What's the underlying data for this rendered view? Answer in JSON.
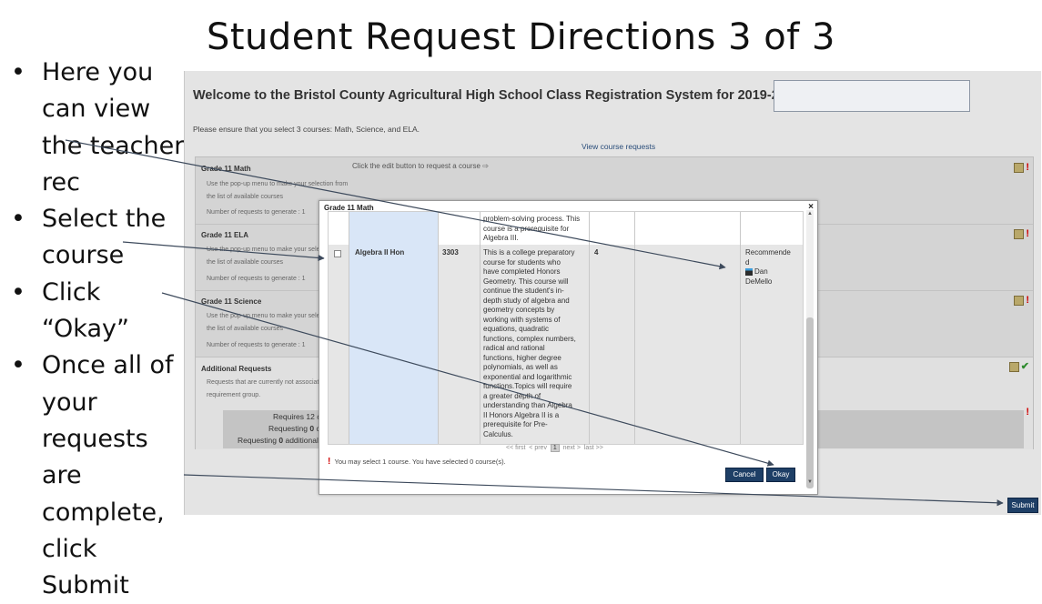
{
  "slide": {
    "title": "Student Request Directions 3 of 3",
    "bullets": [
      [
        "Here you",
        "can view",
        "the teacher",
        "rec"
      ],
      [
        "Select the",
        "course"
      ],
      [
        "Click “Okay”"
      ],
      [
        "Once all of",
        "your",
        "requests are",
        "complete,",
        "click Submit"
      ]
    ]
  },
  "app": {
    "welcome": "Welcome to the Bristol County Agricultural High School Class Registration System for 2019-2020",
    "ensure_text": "Please ensure that you select 3 courses: Math, Science, and ELA.",
    "view_requests_link": "View course requests",
    "edit_hint": "Click the edit button to request a course ⇨",
    "groups": [
      {
        "title": "Grade 11 Math",
        "line1": "Use the pop-up menu to make your selection from",
        "line2": "the list of available courses",
        "line3": "Number of requests to generate : 1"
      },
      {
        "title": "Grade 11 ELA",
        "line1": "Use the pop-up menu to make your selection from",
        "line2": "the list of available courses",
        "line3": "Number of requests to generate : 1"
      },
      {
        "title": "Grade 11 Science",
        "line1": "Use the pop-up menu to make your selection from",
        "line2": "the list of available courses",
        "line3": "Number of requests to generate : 1"
      },
      {
        "title": "Additional Requests",
        "line1": "Requests that are currently not associated with a",
        "line2": "requirement group."
      }
    ],
    "summary": {
      "line1": "Requires 12 cre",
      "line2_pre": "Requesting ",
      "line2_num": "0",
      "line2_post": " cre",
      "line3_pre": "Requesting ",
      "line3_num": "0",
      "line3_post": " additional cre"
    },
    "submit_label": "Submit",
    "status_colors": {
      "required": "#d10000",
      "complete": "#2e8b2e"
    }
  },
  "modal": {
    "title": "Grade 11 Math",
    "close": "×",
    "prev_desc": [
      "problem-solving process. This",
      "course is a prerequisite for",
      "Algebra III."
    ],
    "course": {
      "name": "Algebra II Hon",
      "number": "3303",
      "description": [
        "This is a college preparatory",
        "course for students who",
        "have completed Honors",
        "Geometry. This course will",
        "continue the student's in-",
        "depth study of algebra and",
        "geometry concepts by",
        "working with systems of",
        "equations, quadratic",
        "functions, complex numbers,",
        "radical and rational",
        "functions, higher degree",
        "polynomials, as well as",
        "exponential and logarithmic",
        "functions.Topics will require",
        "a greater depth of",
        "understanding than Algebra",
        "II Honors Algebra II is a",
        "prerequisite for Pre-",
        "Calculus."
      ],
      "credits": "4",
      "rec_line1": "Recommende",
      "rec_line2": "d",
      "teacher_first": "Dan",
      "teacher_last": "DeMello"
    },
    "pager": {
      "first": "<< first",
      "prev": "< prev",
      "page": "1",
      "next": "next >",
      "last": "last >>"
    },
    "message": "You may select 1 course.  You have selected 0 course(s).",
    "cancel_label": "Cancel",
    "okay_label": "Okay"
  }
}
